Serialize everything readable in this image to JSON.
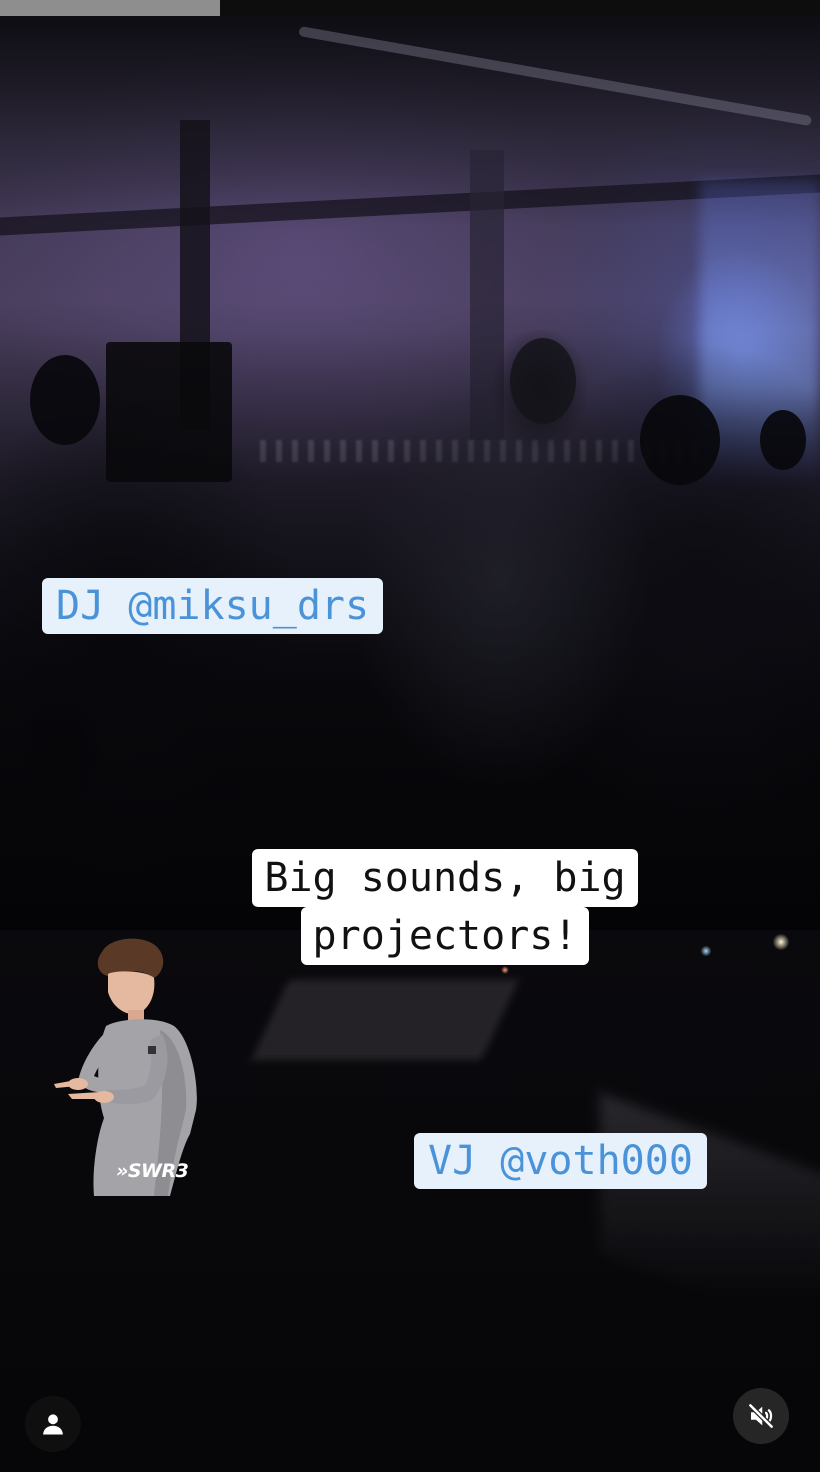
{
  "story": {
    "progress_fraction": 0.268,
    "stickers": {
      "dj_tag": "DJ @miksu_drs",
      "vj_tag": "VJ @voth000",
      "caption_line1": "Big sounds, big",
      "caption_line2": "projectors!",
      "gif_brand": "»SWR3"
    },
    "controls": {
      "profile_icon": "user-icon",
      "mute_icon": "speaker-muted-icon"
    },
    "colors": {
      "tag_background": "#e6f1fb",
      "tag_text": "#4b93d9",
      "caption_background": "#ffffff",
      "progress_fill": "#8e8e8e"
    }
  }
}
